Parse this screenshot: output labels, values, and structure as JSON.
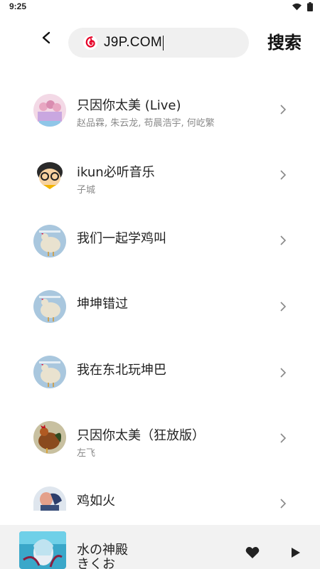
{
  "status_bar": {
    "time": "9:25"
  },
  "header": {
    "back_label": "<",
    "search_value": "J9P.COM",
    "search_button": "搜索"
  },
  "results": [
    {
      "title": "只因你太美 (Live)",
      "subtitle": "赵品霖, 朱云龙, 苟晨浩宇, 何屹繁",
      "avatar": "pink-girls"
    },
    {
      "title": "ikun必听音乐",
      "subtitle": "子城",
      "avatar": "cartoon-face"
    },
    {
      "title": "我们一起学鸡叫",
      "subtitle": "",
      "avatar": "chicken"
    },
    {
      "title": "坤坤错过",
      "subtitle": "",
      "avatar": "chicken"
    },
    {
      "title": "我在东北玩坤巴",
      "subtitle": "",
      "avatar": "chicken"
    },
    {
      "title": "只因你太美（狂放版）",
      "subtitle": "左飞",
      "avatar": "rooster"
    },
    {
      "title": "鸡如火",
      "subtitle": "",
      "avatar": "anime"
    }
  ],
  "player": {
    "title": "水の神殿",
    "artist": "きくお"
  },
  "colors": {
    "accent": "#e60026",
    "text": "#222222",
    "subtext": "#8a8a8a",
    "search_bg": "#f0f0f0",
    "player_bg": "#f2f2f2"
  }
}
